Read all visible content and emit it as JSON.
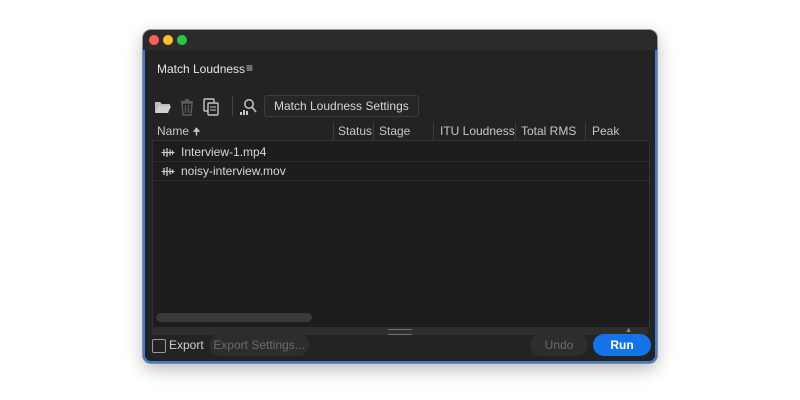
{
  "panel": {
    "title": "Match Loudness",
    "menu_icon": "≡"
  },
  "toolbar": {
    "icons": [
      "folder-open-icon",
      "trash-icon",
      "copy-icon",
      "search-person-icon"
    ],
    "settings_button": "Match Loudness Settings"
  },
  "table": {
    "columns": [
      "Name",
      "Status",
      "Stage",
      "ITU Loudness",
      "Total RMS",
      "Peak"
    ],
    "sort_indicator": "🠉",
    "rows": [
      {
        "name": "Interview-1.mp4",
        "icon": "audio-waveform-icon"
      },
      {
        "name": "noisy-interview.mov",
        "icon": "audio-waveform-icon"
      }
    ]
  },
  "footer": {
    "export_label": "Export",
    "export_checked": false,
    "export_settings_button": "Export Settings...",
    "undo_button": "Undo",
    "run_button": "Run"
  },
  "colors": {
    "accent": "#1473e6",
    "panel_border": "#3a7fd4",
    "background": "#232323"
  }
}
